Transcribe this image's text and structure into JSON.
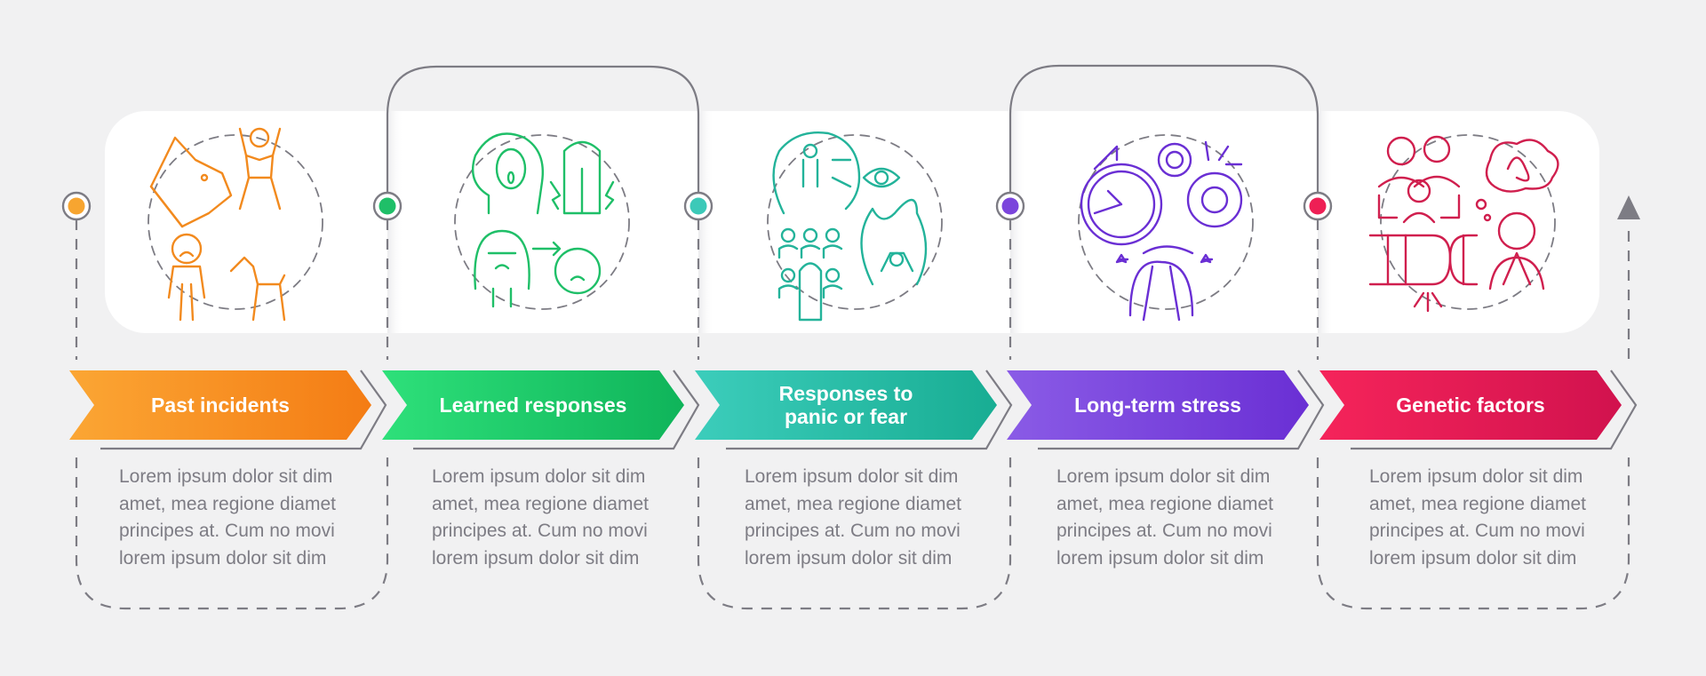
{
  "infographic": {
    "background_color": "#f1f1f2",
    "panel_color": "#ffffff",
    "line_color": "#7d7c84",
    "steps": [
      {
        "title": "Past incidents",
        "description": [
          "Lorem ipsum dolor sit dim",
          "amet, mea regione diamet",
          "principes at. Cum no movi",
          "lorem ipsum dolor sit dim"
        ],
        "icon": "dog-attack-fear-icon",
        "color_start": "#fba634",
        "color_end": "#f47c14"
      },
      {
        "title": "Learned responses",
        "description": [
          "Lorem ipsum dolor sit dim",
          "amet, mea regione diamet",
          "principes at. Cum no movi",
          "lorem ipsum dolor sit dim"
        ],
        "icon": "parent-child-fear-icon",
        "color_start": "#2ee07a",
        "color_end": "#0fb45a"
      },
      {
        "title": "Responses to\npanic or fear",
        "description": [
          "Lorem ipsum dolor sit dim",
          "amet, mea regione diamet",
          "principes at. Cum no movi",
          "lorem ipsum dolor sit dim"
        ],
        "icon": "panic-crowd-icon",
        "color_start": "#3ccdbb",
        "color_end": "#18ad93"
      },
      {
        "title": "Long-term stress",
        "description": [
          "Lorem ipsum dolor sit dim",
          "amet, mea regione diamet",
          "principes at. Cum no movi",
          "lorem ipsum dolor sit dim"
        ],
        "icon": "clock-gears-stress-icon",
        "color_start": "#8a5be6",
        "color_end": "#6a2fd4"
      },
      {
        "title": "Genetic factors",
        "description": [
          "Lorem ipsum dolor sit dim",
          "amet, mea regione diamet",
          "principes at. Cum no movi",
          "lorem ipsum dolor sit dim"
        ],
        "icon": "family-dna-anxiety-icon",
        "color_start": "#f5245a",
        "color_end": "#d1124e"
      }
    ],
    "node_colors": [
      "#f7a530",
      "#1fbf68",
      "#3cc9b8",
      "#7b45dc",
      "#ee1f55"
    ],
    "icon_colors": [
      "#f28a1e",
      "#1fbf68",
      "#23b39a",
      "#6a2fd4",
      "#d01f4e"
    ]
  }
}
